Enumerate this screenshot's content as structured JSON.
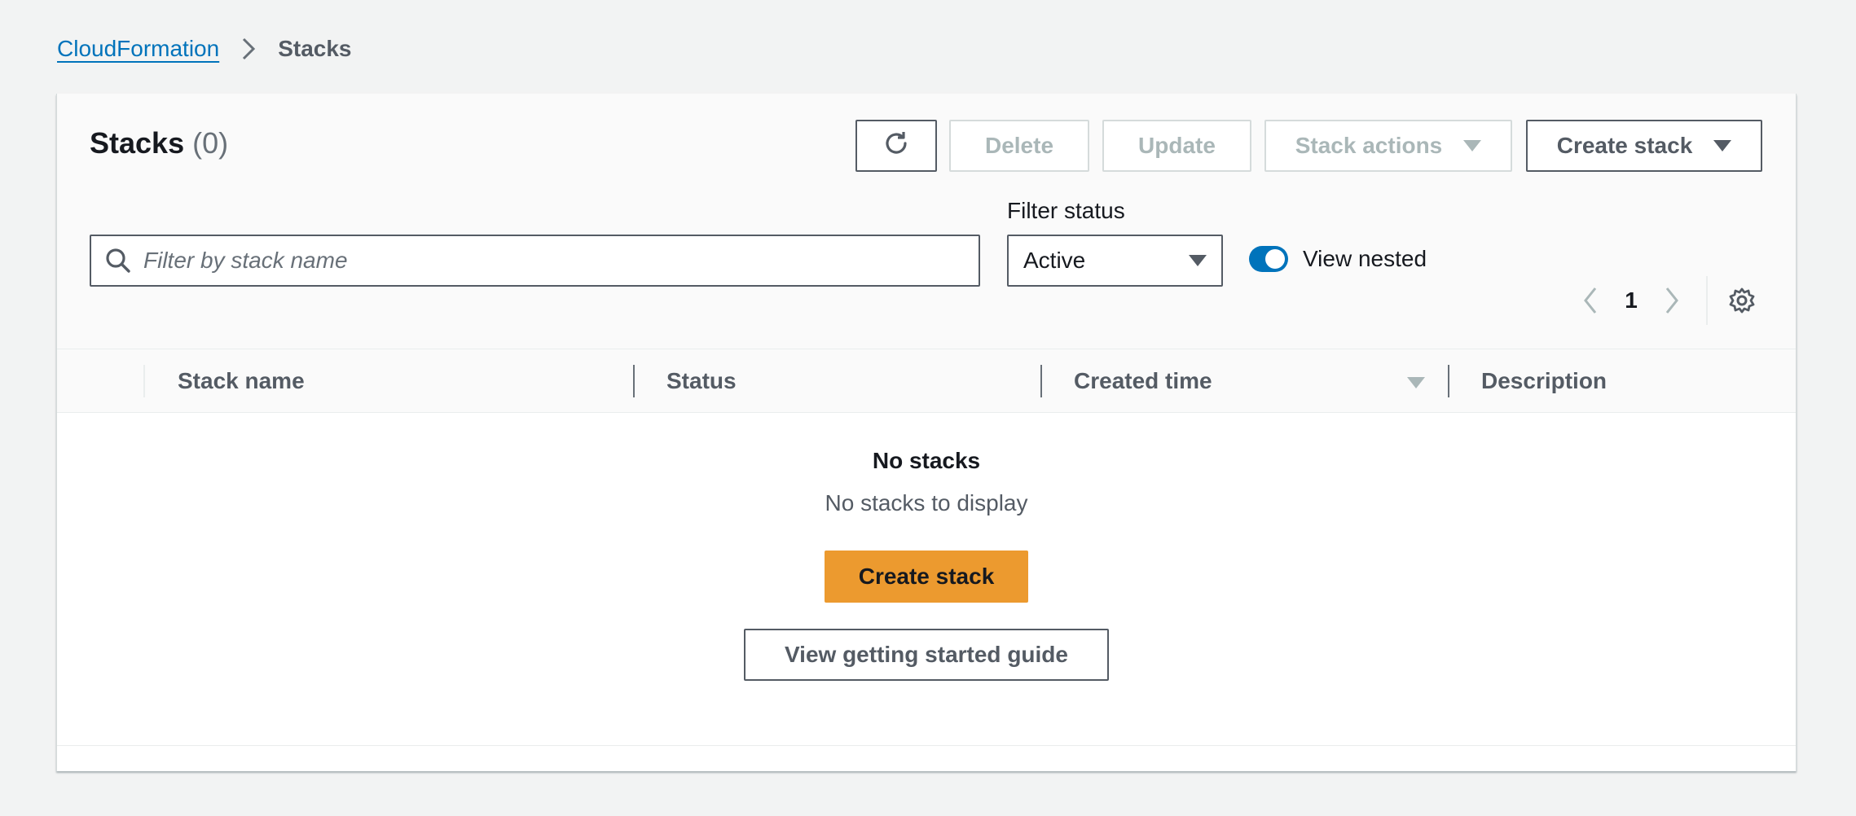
{
  "breadcrumb": {
    "root_label": "CloudFormation",
    "separator_icon": "chevron-right-icon",
    "current_label": "Stacks"
  },
  "header": {
    "title": "Stacks",
    "count": "(0)"
  },
  "toolbar": {
    "refresh_icon": "refresh-icon",
    "delete_label": "Delete",
    "update_label": "Update",
    "stack_actions_label": "Stack actions",
    "create_stack_label": "Create stack"
  },
  "search": {
    "placeholder": "Filter by stack name",
    "value": ""
  },
  "filter_status": {
    "label": "Filter status",
    "selected": "Active"
  },
  "view_nested": {
    "label": "View nested",
    "enabled": true
  },
  "pagination": {
    "current_page": "1"
  },
  "table": {
    "columns": [
      "Stack name",
      "Status",
      "Created time",
      "Description"
    ],
    "sorted_column": "Created time",
    "sort_direction": "descending"
  },
  "empty_state": {
    "title": "No stacks",
    "subtitle": "No stacks to display",
    "primary_button": "Create stack",
    "secondary_button": "View getting started guide"
  },
  "colors": {
    "link": "#0073bb",
    "primary_button": "#ec9a2f",
    "toggle_on": "#0073bb",
    "background": "#f2f3f3"
  }
}
